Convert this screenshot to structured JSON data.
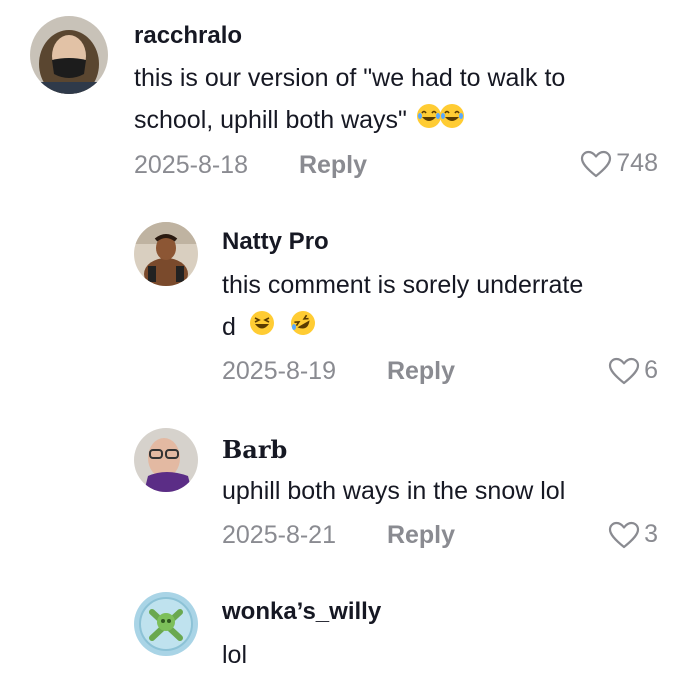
{
  "comments": [
    {
      "username": "racchralo",
      "text_line1": "this is our version of \"we had to walk to",
      "text_line2": "school, uphill both ways\"",
      "date": "2025-8-18",
      "reply_label": "Reply",
      "likes": "748",
      "emojis": [
        "joy-emoji",
        "joy-emoji"
      ]
    },
    {
      "username": "Natty Pro",
      "text_line1": "this comment is sorely underrate",
      "text_line2": "d",
      "date": "2025-8-19",
      "reply_label": "Reply",
      "likes": "6",
      "emojis": [
        "laughing-emoji",
        "rofl-emoji"
      ]
    },
    {
      "username": "Barb",
      "text_line1": "uphill both ways in the snow lol",
      "date": "2025-8-21",
      "reply_label": "Reply",
      "likes": "3"
    },
    {
      "username": "wonka’s_willy",
      "text_line1": "lol"
    }
  ],
  "colors": {
    "text": "#161823",
    "muted": "#8a8b91",
    "emoji_yellow": "#ffcc33"
  }
}
